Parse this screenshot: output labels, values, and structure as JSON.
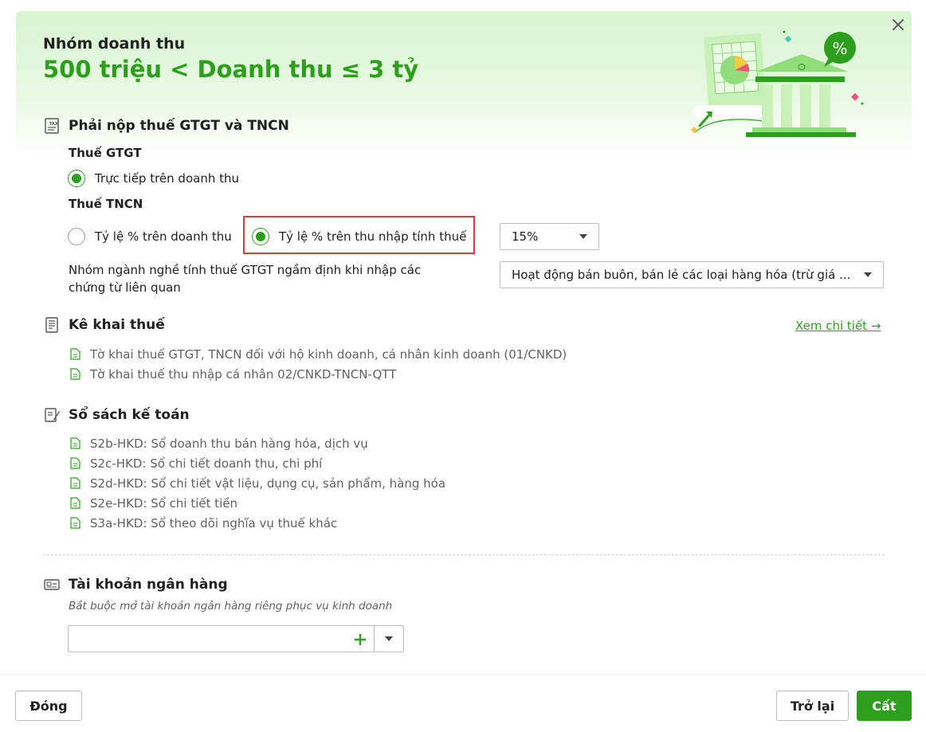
{
  "header": {
    "subtitle": "Nhóm doanh thu",
    "title": "500 triệu < Doanh thu ≤ 3 tỷ",
    "illustration_badge": "%"
  },
  "tax_section": {
    "heading": "Phải nộp thuế GTGT và TNCN",
    "gtgt_label": "Thuế GTGT",
    "gtgt_option": "Trực tiếp trên doanh thu",
    "tncn_label": "Thuế TNCN",
    "tncn_option_revenue": "Tỷ lệ % trên doanh thu",
    "tncn_option_income": "Tỷ lệ % trên thu nhập tính thuế",
    "tncn_selected": "tncn_option_income",
    "rate_value": "15%",
    "industry_label": "Nhóm ngành nghề tính thuế GTGT ngầm định khi nhập các chứng từ liên quan",
    "industry_value": "Hoạt động bán buôn, bán lẻ các loại hàng hóa (trừ giá ..."
  },
  "declaration": {
    "heading": "Kê khai thuế",
    "detail_link": "Xem chi tiết →",
    "items": [
      "Tờ khai thuế GTGT, TNCN đối với hộ kinh doanh, cá nhân kinh doanh (01/CNKD)",
      "Tờ khai thuế thu nhập cá nhân 02/CNKD-TNCN-QTT"
    ]
  },
  "books": {
    "heading": "Sổ sách kế toán",
    "items": [
      "S2b-HKD: Sổ doanh thu bán hàng hóa, dịch vụ",
      "S2c-HKD: Sổ chi tiết doanh thu, chi phí",
      "S2d-HKD: Sổ chi tiết vật liệu, dụng cụ, sản phẩm, hàng hóa",
      "S2e-HKD: Sổ chi tiết tiền",
      "S3a-HKD: Sổ theo dõi nghĩa vụ thuế khác"
    ]
  },
  "bank": {
    "heading": "Tài khoản ngân hàng",
    "hint": "Bắt buộc mở tài khoản ngân hàng riêng phục vụ kinh doanh",
    "value": ""
  },
  "footer": {
    "close_label": "Đóng",
    "back_label": "Trở lại",
    "save_label": "Cất"
  },
  "colors": {
    "accent": "#2ca01c",
    "highlight": "#e53935"
  }
}
